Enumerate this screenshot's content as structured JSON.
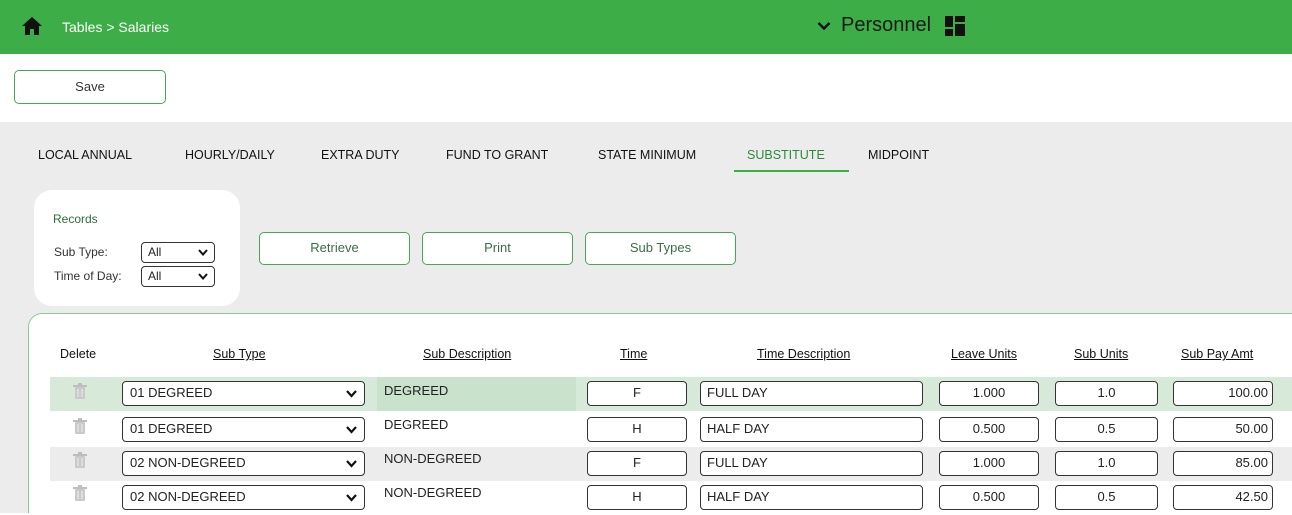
{
  "header": {
    "breadcrumb": "Tables > Salaries",
    "app_name": "Personnel"
  },
  "toolbar": {
    "save_label": "Save"
  },
  "tabs": [
    {
      "label": "LOCAL ANNUAL",
      "active": false
    },
    {
      "label": "HOURLY/DAILY",
      "active": false
    },
    {
      "label": "EXTRA DUTY",
      "active": false
    },
    {
      "label": "FUND TO GRANT",
      "active": false
    },
    {
      "label": "STATE MINIMUM",
      "active": false
    },
    {
      "label": "SUBSTITUTE",
      "active": true
    },
    {
      "label": "MIDPOINT",
      "active": false
    }
  ],
  "records": {
    "title": "Records",
    "sub_type_label": "Sub Type:",
    "sub_type_value": "All",
    "time_of_day_label": "Time of Day:",
    "time_of_day_value": "All"
  },
  "actions": {
    "retrieve": "Retrieve",
    "print": "Print",
    "sub_types": "Sub Types"
  },
  "table": {
    "columns": {
      "delete": "Delete",
      "sub_type": "Sub Type",
      "sub_description": "Sub Description",
      "time": "Time",
      "time_description": "Time Description",
      "leave_units": "Leave Units",
      "sub_units": "Sub Units",
      "sub_pay_amt": "Sub Pay Amt"
    },
    "rows": [
      {
        "sub_type": "01 DEGREED",
        "sub_description": "DEGREED",
        "time": "F",
        "time_description": "FULL DAY",
        "leave_units": "1.000",
        "sub_units": "1.0",
        "sub_pay_amt": "100.00"
      },
      {
        "sub_type": "01 DEGREED",
        "sub_description": "DEGREED",
        "time": "H",
        "time_description": "HALF DAY",
        "leave_units": "0.500",
        "sub_units": "0.5",
        "sub_pay_amt": "50.00"
      },
      {
        "sub_type": "02 NON-DEGREED",
        "sub_description": "NON-DEGREED",
        "time": "F",
        "time_description": "FULL DAY",
        "leave_units": "1.000",
        "sub_units": "1.0",
        "sub_pay_amt": "85.00"
      },
      {
        "sub_type": "02 NON-DEGREED",
        "sub_description": "NON-DEGREED",
        "time": "H",
        "time_description": "HALF DAY",
        "leave_units": "0.500",
        "sub_units": "0.5",
        "sub_pay_amt": "42.50"
      }
    ]
  },
  "colors": {
    "brand_green": "#3dad48",
    "selected_row": "#d7ead9",
    "alt_row": "#ececec"
  }
}
